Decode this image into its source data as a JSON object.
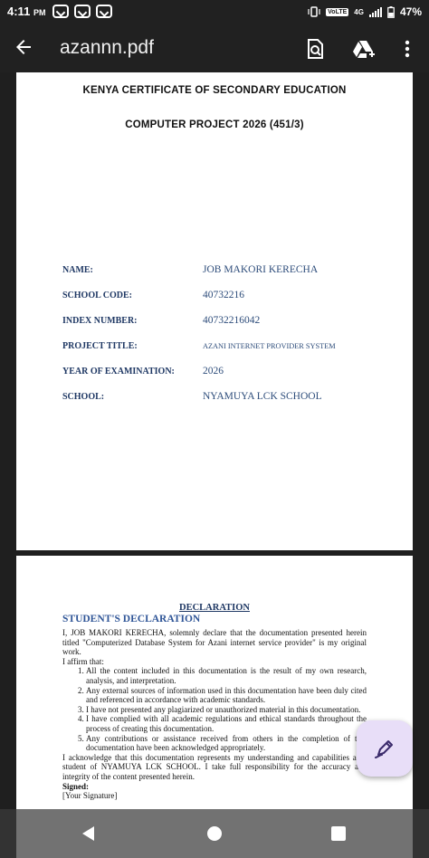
{
  "status_bar": {
    "time": "4:11",
    "ampm": "PM",
    "volte": "VoLTE",
    "network": "4G",
    "battery": "47%"
  },
  "app_bar": {
    "title": "azannn.pdf"
  },
  "page1": {
    "heading1": "KENYA CERTIFICATE OF SECONDARY EDUCATION",
    "heading2": "COMPUTER PROJECT 2026 (451/3)",
    "fields": [
      {
        "label": "NAME:",
        "value": "JOB MAKORI KERECHA"
      },
      {
        "label": "SCHOOL CODE:",
        "value": "40732216"
      },
      {
        "label": "INDEX NUMBER:",
        "value": "40732216042"
      },
      {
        "label": "PROJECT TITLE:",
        "value": "AZANI INTERNET PROVIDER SYSTEM"
      },
      {
        "label": "YEAR OF EXAMINATION:",
        "value": "2026"
      },
      {
        "label": "SCHOOL:",
        "value": "NYAMUYA LCK SCHOOL"
      }
    ]
  },
  "page2": {
    "declaration_heading": "DECLARATION",
    "student_declaration": "STUDENT'S DECLARATION",
    "intro": "I, JOB MAKORI KERECHA, solemnly declare that the documentation presented herein titled \"Computerized Database System for Azani internet service provider\" is my original work.",
    "affirm": "I affirm that:",
    "items": [
      "All the content included in this documentation is the result of my own research, analysis, and interpretation.",
      "Any external sources of information used in this documentation have been duly cited and referenced in accordance with academic standards.",
      "I have not presented any plagiarized or unauthorized material in this documentation.",
      "I have complied with all academic regulations and ethical standards throughout the process of creating this documentation.",
      "Any contributions or assistance received from others in the completion of this documentation have been acknowledged appropriately."
    ],
    "closing": "I acknowledge that this documentation represents my understanding and capabilities as a student of NYAMUYA LCK SCHOOL. I take full responsibility for the accuracy and integrity of the content presented herein.",
    "signed": "Signed:",
    "signature": "[Your Signature]"
  },
  "icons": {
    "back": "arrow-back-icon",
    "search": "document-search-icon",
    "drive": "drive-add-icon",
    "more": "more-vert-icon",
    "edit": "pen-edit-icon"
  }
}
